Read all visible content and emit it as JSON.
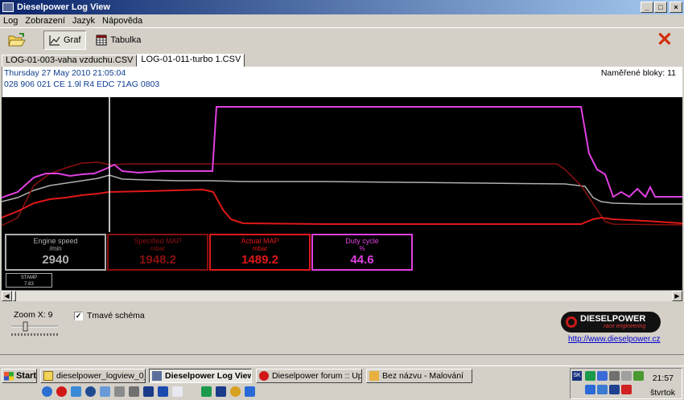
{
  "window": {
    "title": "Dieselpower Log View",
    "buttons": [
      "_",
      "□",
      "×"
    ]
  },
  "menu": [
    "Log",
    "Zobrazení",
    "Jazyk",
    "Nápověda"
  ],
  "toolbar": {
    "graph_label": "Graf",
    "table_label": "Tabulka"
  },
  "tabs": [
    "LOG-01-003-vaha vzduchu.CSV",
    "LOG-01-011-turbo 1.CSV"
  ],
  "active_tab": 1,
  "info": {
    "datetime": "Thursday 27 May 2010 21:05:04",
    "ecu": "028 906 021 CE  1.9l R4 EDC   71AG  0803",
    "blocks": "Naměřené bloky: 11"
  },
  "chart_data": {
    "type": "line",
    "cursor_x": 134,
    "x_range": [
      0,
      846
    ],
    "series": [
      {
        "name": "Engine speed",
        "color": "#b0b0b0",
        "points": [
          [
            0,
            130
          ],
          [
            20,
            125
          ],
          [
            40,
            116
          ],
          [
            60,
            110
          ],
          [
            80,
            107
          ],
          [
            100,
            104
          ],
          [
            120,
            101
          ],
          [
            134,
            97
          ],
          [
            150,
            102
          ],
          [
            180,
            103
          ],
          [
            220,
            104
          ],
          [
            260,
            104
          ],
          [
            300,
            105
          ],
          [
            400,
            105
          ],
          [
            500,
            106
          ],
          [
            600,
            107
          ],
          [
            700,
            108
          ],
          [
            725,
            111
          ],
          [
            735,
            125
          ],
          [
            745,
            130
          ],
          [
            760,
            132
          ],
          [
            800,
            133
          ],
          [
            846,
            133
          ]
        ]
      },
      {
        "name": "Specified MAP",
        "color": "#8a1010",
        "points": [
          [
            0,
            160
          ],
          [
            20,
            150
          ],
          [
            30,
            130
          ],
          [
            40,
            110
          ],
          [
            60,
            95
          ],
          [
            80,
            88
          ],
          [
            100,
            82
          ],
          [
            120,
            81
          ],
          [
            134,
            84
          ],
          [
            160,
            83
          ],
          [
            260,
            83
          ],
          [
            500,
            83
          ],
          [
            690,
            83
          ],
          [
            700,
            90
          ],
          [
            720,
            110
          ],
          [
            740,
            140
          ],
          [
            750,
            155
          ],
          [
            760,
            158
          ],
          [
            846,
            159
          ]
        ]
      },
      {
        "name": "Actual MAP",
        "color": "#e01818",
        "points": [
          [
            0,
            150
          ],
          [
            20,
            142
          ],
          [
            40,
            132
          ],
          [
            60,
            127
          ],
          [
            80,
            125
          ],
          [
            100,
            122
          ],
          [
            120,
            120
          ],
          [
            134,
            118
          ],
          [
            180,
            117
          ],
          [
            250,
            115
          ],
          [
            263,
            118
          ],
          [
            275,
            140
          ],
          [
            285,
            152
          ],
          [
            300,
            157
          ],
          [
            400,
            158
          ],
          [
            600,
            158
          ],
          [
            720,
            158
          ],
          [
            735,
            152
          ],
          [
            745,
            150
          ],
          [
            760,
            152
          ],
          [
            800,
            154
          ],
          [
            846,
            157
          ]
        ]
      },
      {
        "name": "Duty cycle",
        "color": "#e040e0",
        "points": [
          [
            0,
            125
          ],
          [
            20,
            118
          ],
          [
            40,
            100
          ],
          [
            55,
            95
          ],
          [
            70,
            95
          ],
          [
            85,
            98
          ],
          [
            100,
            96
          ],
          [
            115,
            95
          ],
          [
            130,
            89
          ],
          [
            140,
            84
          ],
          [
            150,
            92
          ],
          [
            170,
            94
          ],
          [
            200,
            92
          ],
          [
            262,
            92
          ],
          [
            267,
            12
          ],
          [
            720,
            12
          ],
          [
            730,
            70
          ],
          [
            740,
            90
          ],
          [
            750,
            96
          ],
          [
            760,
            124
          ],
          [
            770,
            118
          ],
          [
            780,
            124
          ],
          [
            790,
            114
          ],
          [
            800,
            124
          ],
          [
            806,
            112
          ],
          [
            812,
            124
          ],
          [
            846,
            124
          ]
        ]
      }
    ]
  },
  "gauges": [
    {
      "name": "Engine speed",
      "unit": "/min",
      "value": "2940",
      "color": "#b0b0b0"
    },
    {
      "name": "Specified MAP",
      "unit": "mbar",
      "value": "1948.2",
      "color": "#8a1010"
    },
    {
      "name": "Actual MAP",
      "unit": "mbar",
      "value": "1489.2",
      "color": "#e01818"
    },
    {
      "name": "Duty cycle",
      "unit": "%",
      "value": "44.6",
      "color": "#e040e0"
    }
  ],
  "stamp": {
    "label": "STAMP",
    "value": "7.83"
  },
  "zoom": {
    "label": "Zoom X: 9",
    "value": 9
  },
  "dark_scheme": {
    "label": "Tmavé schéma",
    "checked": true,
    "mark": "✓"
  },
  "logo": {
    "title": "DIESELPOWER",
    "subtitle": "race engineering"
  },
  "website": "http://www.dieselpower.cz",
  "taskbar": {
    "start": "Start",
    "tasks": [
      "dieselpower_logview_0_...",
      "Dieselpower Log View",
      "Dieselpower forum :: Upl...",
      "Bez názvu - Malování"
    ],
    "active_task": 1,
    "clock": "21:57",
    "day": "štvrtok",
    "lang": "SK"
  },
  "colors": {
    "accent": "#0a246a",
    "close_x": "#d42d0c"
  }
}
